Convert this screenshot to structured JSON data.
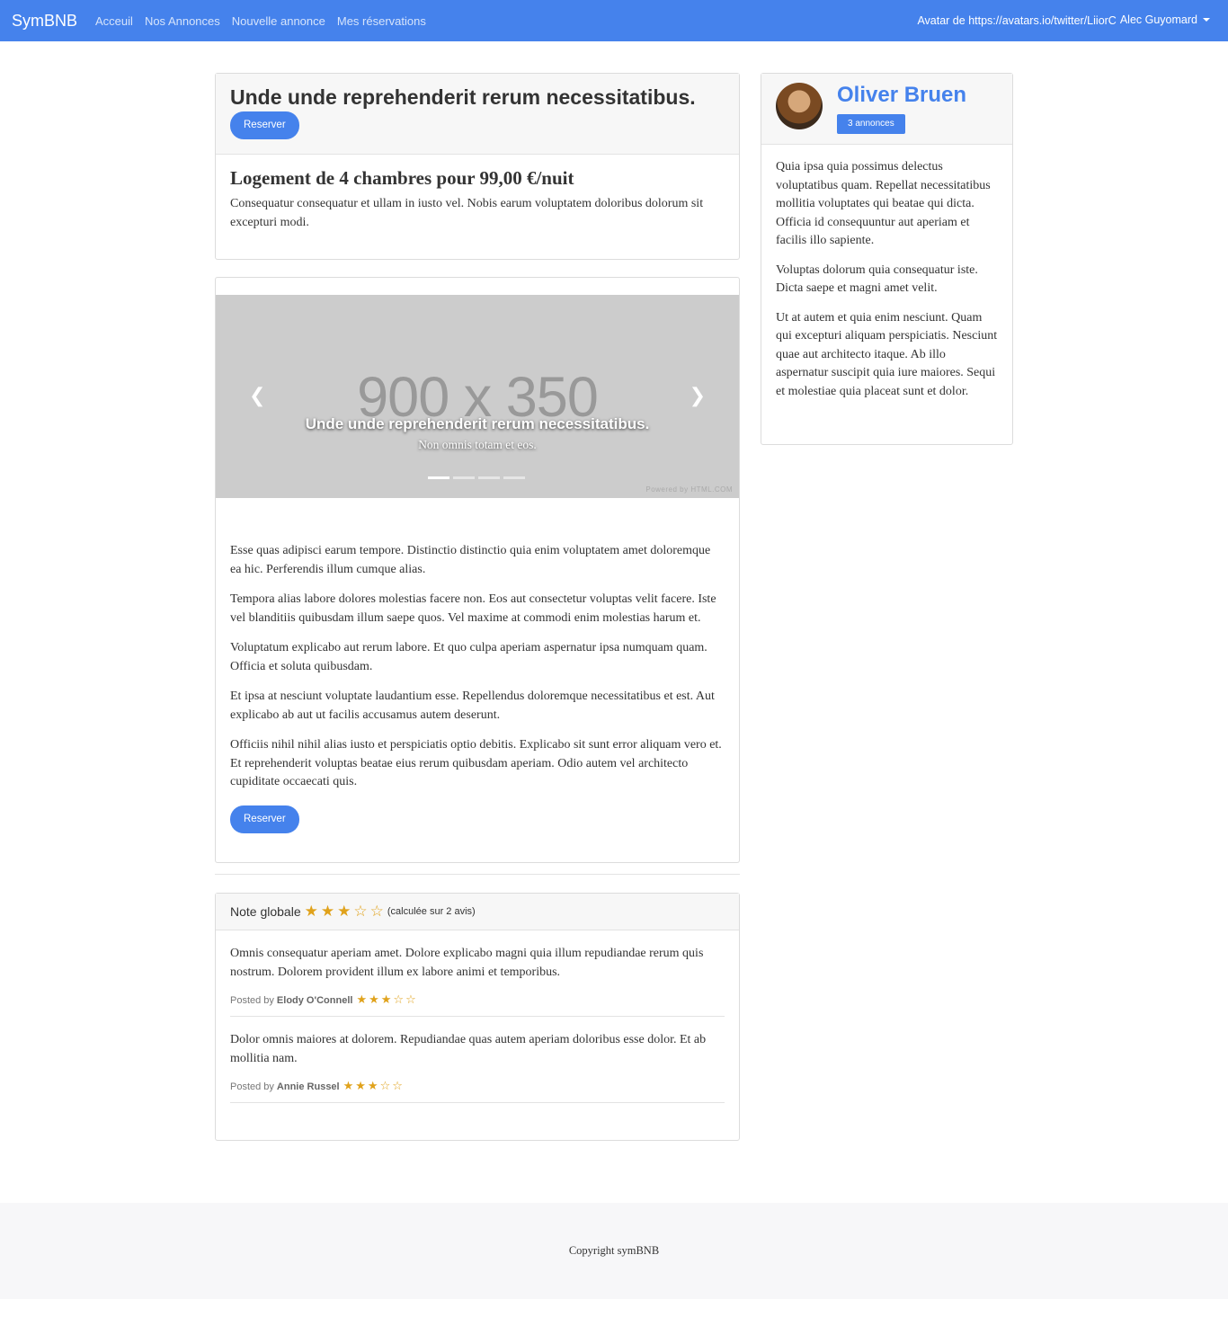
{
  "nav": {
    "brand": "SymBNB",
    "links": [
      "Acceuil",
      "Nos Annonces",
      "Nouvelle annonce",
      "Mes réservations"
    ],
    "avatar_alt": "Avatar de https://avatars.io/twitter/LiiorC",
    "user_name": "Alec Guyomard"
  },
  "ad": {
    "title": "Unde unde reprehenderit rerum necessitatibus.",
    "reserve_label": "Reserver",
    "subtitle": "Logement de 4 chambres pour 99,00 €/nuit",
    "intro": "Consequatur consequatur et ullam in iusto vel. Nobis earum voluptatem doloribus dolorum sit excepturi modi."
  },
  "carousel": {
    "placeholder": "900 x 350",
    "caption_title": "Unde unde reprehenderit rerum necessitatibus.",
    "caption_sub": "Non omnis totam et eos.",
    "prev_glyph": "❮",
    "next_glyph": "❯",
    "powered_by": "Powered by HTML.COM",
    "slide_count": 4,
    "active_slide": 1
  },
  "content": {
    "paragraphs": [
      "Esse quas adipisci earum tempore. Distinctio distinctio quia enim voluptatem amet doloremque ea hic. Perferendis illum cumque alias.",
      "Tempora alias labore dolores molestias facere non. Eos aut consectetur voluptas velit facere. Iste vel blanditiis quibusdam illum saepe quos. Vel maxime at commodi enim molestias harum et.",
      "Voluptatum explicabo aut rerum labore. Et quo culpa aperiam aspernatur ipsa numquam quam. Officia et soluta quibusdam.",
      "Et ipsa at nesciunt voluptate laudantium esse. Repellendus doloremque necessitatibus et est. Aut explicabo ab aut ut facilis accusamus autem deserunt.",
      "Officiis nihil nihil alias iusto et perspiciatis optio debitis. Explicabo sit sunt error aliquam vero et. Et reprehenderit voluptas beatae eius rerum quibusdam aperiam. Odio autem vel architecto cupiditate occaecati quis."
    ],
    "reserve_label": "Reserver"
  },
  "reviews": {
    "global_label": "Note globale",
    "global_rating": 3,
    "max_rating": 5,
    "note": "(calculée sur 2 avis)",
    "posted_by": "Posted by",
    "items": [
      {
        "text": "Omnis consequatur aperiam amet. Dolore explicabo magni quia illum repudiandae rerum quis nostrum. Dolorem provident illum ex labore animi et temporibus.",
        "author": "Elody O'Connell",
        "rating": 3
      },
      {
        "text": "Dolor omnis maiores at dolorem. Repudiandae quas autem aperiam doloribus esse dolor. Et ab mollitia nam.",
        "author": "Annie Russel",
        "rating": 3
      }
    ]
  },
  "author": {
    "name": "Oliver Bruen",
    "badge": "3 annonces",
    "bio": [
      "Quia ipsa quia possimus delectus voluptatibus quam. Repellat necessitatibus mollitia voluptates qui beatae qui dicta. Officia id consequuntur aut aperiam et facilis illo sapiente.",
      "Voluptas dolorum quia consequatur iste. Dicta saepe et magni amet velit.",
      "Ut at autem et quia enim nesciunt. Quam qui excepturi aliquam perspiciatis. Nesciunt quae aut architecto itaque. Ab illo aspernatur suscipit quia iure maiores. Sequi et molestiae quia placeat sunt et dolor."
    ]
  },
  "footer": {
    "text": "Copyright symBNB"
  },
  "colors": {
    "primary": "#4582ec",
    "star": "#e0a21b",
    "carousel_bg": "#cccccc"
  },
  "icons": {
    "star_full": "★",
    "star_empty": "☆",
    "prev": "chevron-left-icon",
    "next": "chevron-right-icon",
    "caret": "caret-down-icon"
  }
}
